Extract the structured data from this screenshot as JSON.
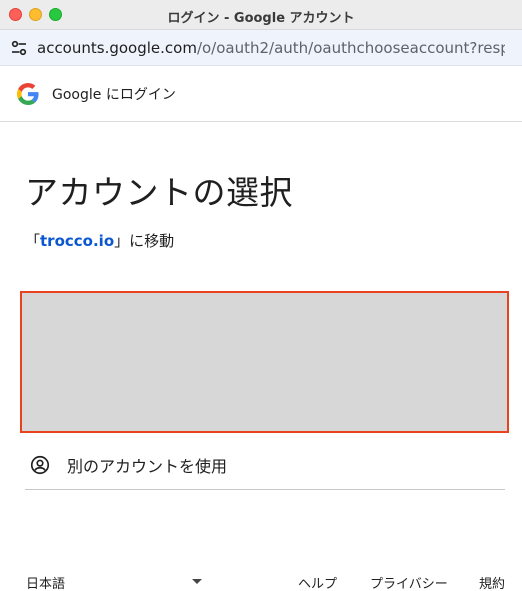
{
  "window": {
    "title": "ログイン - Google アカウント",
    "controls": {
      "close": "close-button",
      "minimize": "minimize-button",
      "maximize": "maximize-button"
    }
  },
  "address_bar": {
    "icon": "site-settings-icon",
    "host": "accounts.google.com",
    "path": "/o/oauth2/auth/oauthchooseaccount?respo..."
  },
  "google_header": {
    "logo": "google-g-logo",
    "text": "Google にログイン"
  },
  "main": {
    "heading": "アカウントの選択",
    "subtitle_prefix": "「",
    "app_name": "trocco.io",
    "subtitle_suffix": "」に移動",
    "use_other_account": {
      "icon": "account-circle-icon",
      "label": "別のアカウントを使用"
    }
  },
  "footer": {
    "language": "日本語",
    "help": "ヘルプ",
    "privacy": "プライバシー",
    "terms": "規約"
  },
  "colors": {
    "accent_link": "#0b57d0",
    "highlight_border": "#e8421e",
    "placeholder_fill": "#d7d7d7"
  }
}
